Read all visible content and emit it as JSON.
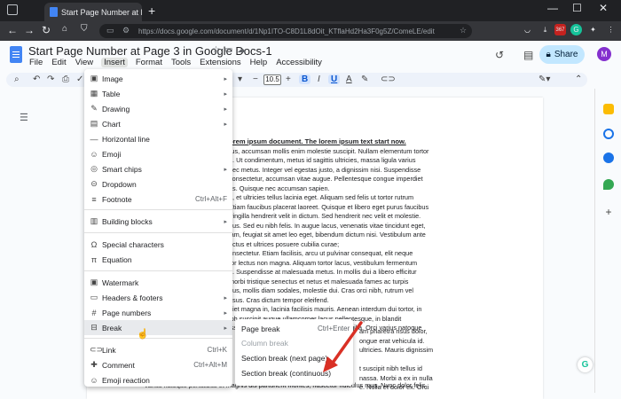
{
  "browser": {
    "tab_title": "Start Page Number at Page 3 in",
    "url": "https://docs.google.com/document/d/1Np1ITO-C8D1L8dOit_KTflaHd2Ha3F0g5Z/ComeLE/edit",
    "ext_badge": "367"
  },
  "doc": {
    "title": "Start Page Number at Page 3 in Google Docs-1",
    "menus": [
      "File",
      "Edit",
      "View",
      "Insert",
      "Format",
      "Tools",
      "Extensions",
      "Help",
      "Accessibility"
    ],
    "share_label": "Share",
    "avatar_letter": "M",
    "font_size": "10.5"
  },
  "insert_menu": {
    "items": [
      {
        "icon": "image-icon",
        "glyph": "▣",
        "label": "Image",
        "shortcut": "",
        "arrow": true
      },
      {
        "icon": "table-icon",
        "glyph": "▦",
        "label": "Table",
        "shortcut": "",
        "arrow": true
      },
      {
        "icon": "drawing-icon",
        "glyph": "✎",
        "label": "Drawing",
        "shortcut": "",
        "arrow": true
      },
      {
        "icon": "chart-icon",
        "glyph": "▤",
        "label": "Chart",
        "shortcut": "",
        "arrow": true
      },
      {
        "icon": "horizontal-line-icon",
        "glyph": "—",
        "label": "Horizontal line",
        "shortcut": "",
        "arrow": false
      },
      {
        "icon": "emoji-icon",
        "glyph": "☺",
        "label": "Emoji",
        "shortcut": "",
        "arrow": false
      },
      {
        "icon": "smart-chips-icon",
        "glyph": "◎",
        "label": "Smart chips",
        "shortcut": "",
        "arrow": true
      },
      {
        "icon": "dropdown-icon",
        "glyph": "⊝",
        "label": "Dropdown",
        "shortcut": "",
        "arrow": false
      },
      {
        "icon": "footnote-icon",
        "glyph": "≡",
        "label": "Footnote",
        "shortcut": "Ctrl+Alt+F",
        "arrow": false
      },
      {
        "icon": "building-blocks-icon",
        "glyph": "▥",
        "label": "Building blocks",
        "shortcut": "",
        "arrow": true
      },
      {
        "icon": "special-characters-icon",
        "glyph": "Ω",
        "label": "Special characters",
        "shortcut": "",
        "arrow": false
      },
      {
        "icon": "equation-icon",
        "glyph": "π",
        "label": "Equation",
        "shortcut": "",
        "arrow": false
      },
      {
        "icon": "watermark-icon",
        "glyph": "▣",
        "label": "Watermark",
        "shortcut": "",
        "arrow": false
      },
      {
        "icon": "headers-footers-icon",
        "glyph": "▭",
        "label": "Headers & footers",
        "shortcut": "",
        "arrow": true
      },
      {
        "icon": "page-numbers-icon",
        "glyph": "#",
        "label": "Page numbers",
        "shortcut": "",
        "arrow": true
      },
      {
        "icon": "break-icon",
        "glyph": "⊟",
        "label": "Break",
        "shortcut": "",
        "arrow": true
      },
      {
        "icon": "link-icon",
        "glyph": "⊂⊃",
        "label": "Link",
        "shortcut": "Ctrl+K",
        "arrow": false
      },
      {
        "icon": "comment-icon",
        "glyph": "✚",
        "label": "Comment",
        "shortcut": "Ctrl+Alt+M",
        "arrow": false
      },
      {
        "icon": "emoji-reaction-icon",
        "glyph": "☺",
        "label": "Emoji reaction",
        "shortcut": "",
        "arrow": false
      }
    ]
  },
  "break_submenu": {
    "items": [
      {
        "label": "Page break",
        "shortcut": "Ctrl+Enter",
        "disabled": false
      },
      {
        "label": "Column break",
        "shortcut": "",
        "disabled": true
      },
      {
        "label": "Section break (next page)",
        "shortcut": "",
        "disabled": false
      },
      {
        "label": "Section break (continuous)",
        "shortcut": "",
        "disabled": false
      }
    ]
  },
  "body_text": {
    "heading": "orem ipsum document. The lorem ipsum text start now.",
    "lines": [
      "rus, accumsan mollis enim molestie suscipit. Nullam elementum tortor",
      "n. Ut condimentum, metus id sagittis ultricies, massa ligula varius",
      "nec metus. Integer vel egestas justo, a dignissim nisi. Suspendisse",
      "consectetur, accumsan vitae augue. Pellentesque congue imperdiet",
      "us. Quisque nec accumsan sapien.",
      "n, et ultricies tellus lacinia eget. Aliquam sed felis ut tortor rutrum",
      "Etiam faucibus placerat laoreet. Quisque et libero eget purus faucibus",
      "fringilla hendrerit velit in dictum. Sed hendrerit nec velit et molestie.",
      "bus. Sed eu nibh felis. In augue lacus, venenatis vitae tincidunt eget,",
      "iam, feugiat sit amet leo eget, bibendum dictum nisi. Vestibulum ante",
      "uctus et ultrices posuere cubilia curae;",
      "onsectetur. Etiam facilisis, arcu ut pulvinar consequat, elit neque",
      "tor lectus non magna. Aliquam tortor lacus, vestibulum fermentum",
      "n. Suspendisse at malesuada metus. In mollis dui a libero efficitur",
      "morbi tristique senectus et netus et malesuada fames ac turpis",
      "nus, mollis diam sodales, molestie dui. Cras orci nibh, rutrum vel",
      "risus. Cras dictum tempor eleifend.",
      "diet magna in, lacinia facilisis mauris. Aenean interdum dui tortor, in",
      "ibh suscipit augue ullamcorper lacus pellentesque, in blandit",
      "isse elit eu est mattis, quis iaculis risus fringilla. Orci varius natoque"
    ],
    "right_lines": [
      "am pharetra risus dolor,",
      "ongue erat vehicula id.",
      "ultricies. Mauris dignissim",
      "",
      "t suscipit nibh tellus id",
      "nassa. Morbi a ex in nulla",
      "e. Nulla et dolor ex. Orci"
    ],
    "bottom_line": "varius natoque penatibus et magnis dis parturient montes, nascetur ridiculus mus. Nunc dolor felis,"
  }
}
